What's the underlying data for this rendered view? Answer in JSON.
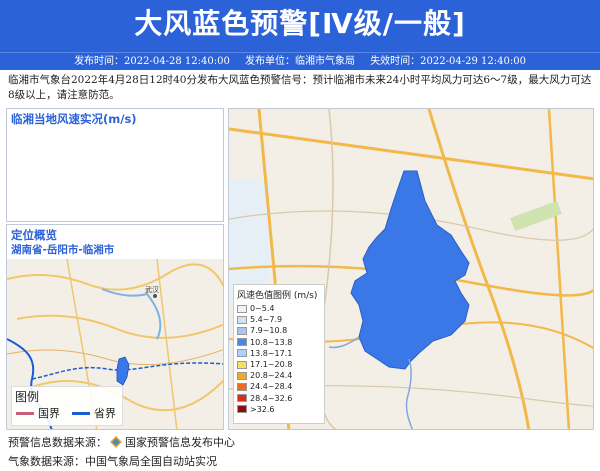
{
  "header": {
    "title": "大风蓝色预警[Ⅳ级/一般]"
  },
  "meta": {
    "issue_time": "发布时间：2022-04-28 12:40:00",
    "issuer": "发布单位：临湘市气象局",
    "expire_time": "失效时间：2022-04-29 12:40:00"
  },
  "description": "临湘市气象台2022年4月28日12时40分发布大风蓝色预警信号：预计临湘市未来24小时平均风力可达6～7级，最大风力可达8级以上，请注意防范。",
  "wind_panel": {
    "title": "临湘当地风速实况(m/s)"
  },
  "location_panel": {
    "title": "定位概览",
    "subtitle": "湖南省-岳阳市-临湘市"
  },
  "map_labels": {
    "wuhan": "武汉"
  },
  "legend": {
    "title": "风速色值图例 (m/s)",
    "items": [
      {
        "label": "0~5.4",
        "color": "#f3f3f3"
      },
      {
        "label": "5.4~7.9",
        "color": "#cfe3f5"
      },
      {
        "label": "7.9~10.8",
        "color": "#a6c8f0"
      },
      {
        "label": "10.8~13.8",
        "color": "#4a86e8"
      },
      {
        "label": "13.8~17.1",
        "color": "#aad4ff"
      },
      {
        "label": "17.1~20.8",
        "color": "#f6e15f"
      },
      {
        "label": "20.8~24.4",
        "color": "#f5a623"
      },
      {
        "label": "24.4~28.4",
        "color": "#f26b1d"
      },
      {
        "label": "28.4~32.6",
        "color": "#d62e1f"
      },
      {
        "label": ">32.6",
        "color": "#8b0f0f"
      }
    ]
  },
  "boundary_legend": {
    "title": "图例",
    "items": [
      {
        "label": "国界",
        "color": "#c8607a"
      },
      {
        "label": "省界",
        "color": "#1a5bd8"
      }
    ]
  },
  "footer": {
    "warning_source": "预警信息数据来源：",
    "warning_source_name": "国家预警信息发布中心",
    "weather_source": "气象数据来源：中国气象局全国自动站实况"
  },
  "colors": {
    "accent": "#2b62d8",
    "region_fill": "#3b78e7"
  },
  "icons": {
    "source_logo": "diamond-logo-icon"
  }
}
